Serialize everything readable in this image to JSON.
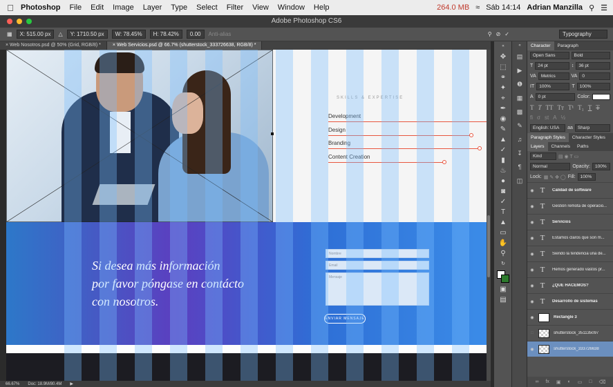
{
  "menubar": {
    "app": "Photoshop",
    "items": [
      "File",
      "Edit",
      "Image",
      "Layer",
      "Type",
      "Select",
      "Filter",
      "View",
      "Window",
      "Help"
    ],
    "memory": "264.0 MB",
    "clock": "Sáb 14:14",
    "user": "Adrian Manzilla"
  },
  "window": {
    "title": "Adobe Photoshop CS6"
  },
  "options": {
    "x": "X: 515.00 px",
    "y": "Y: 1710.50 px",
    "w": "W: 78.45%",
    "h": "H: 78.42%",
    "angle": "0.00",
    "antialias": "Anti-alias",
    "workspace": "Typography"
  },
  "tabs": [
    {
      "label": "Web Nosotros.psd @ 50% (Grid, RGB/8) *"
    },
    {
      "label": "Web Servicios.psd @ 66.7% (shutterstock_333726638, RGB/8) *"
    }
  ],
  "canvas": {
    "skills_title": "SKILLS & EXPERTISE",
    "skills": [
      {
        "label": "Development",
        "level": 1.0
      },
      {
        "label": "Design",
        "level": 0.9
      },
      {
        "label": "Branding",
        "level": 0.95
      },
      {
        "label": "Content Creation",
        "level": 0.73
      }
    ],
    "cta_line1": "Si desea más información",
    "cta_line2": "por favor póngase en contácto",
    "cta_line3": "con nosotros.",
    "form_name": "Nombre",
    "form_email": "Email",
    "form_message": "Mensaje",
    "send_button": "ENVIAR MENSAJE"
  },
  "status": {
    "zoom": "66.67%",
    "doc": "Doc: 18.9M/80.4M"
  },
  "character": {
    "tab1": "Character",
    "tab2": "Paragraph",
    "font": "Open Sans",
    "style": "Bold",
    "size": "24 pt",
    "leading": "36 pt",
    "kerning": "Metrics",
    "tracking": "0",
    "vscale": "100%",
    "hscale": "100%",
    "baseline": "0 pt",
    "color_label": "Color:",
    "language": "English: USA",
    "aa": "Sharp"
  },
  "styles": {
    "tab1": "Paragraph Styles",
    "tab2": "Character Styles"
  },
  "layers_panel": {
    "tab1": "Layers",
    "tab2": "Channels",
    "tab3": "Paths",
    "kind": "Kind",
    "blend": "Normal",
    "opacity_label": "Opacity:",
    "opacity": "100%",
    "lock_label": "Lock:",
    "fill_label": "Fill:",
    "fill": "100%",
    "layers": [
      {
        "name": "Calidad de software",
        "bold": true,
        "type": "text"
      },
      {
        "name": "Gestión remota de operacio...",
        "bold": false,
        "type": "text"
      },
      {
        "name": "Servicios",
        "bold": true,
        "type": "text"
      },
      {
        "name": "Estamos claros que son m...",
        "bold": false,
        "type": "text"
      },
      {
        "name": "Siendo la tendencia una de...",
        "bold": false,
        "type": "text"
      },
      {
        "name": "Hemos generado vastos pr...",
        "bold": false,
        "type": "text"
      },
      {
        "name": "¿QUÉ HACEMOS?",
        "bold": true,
        "type": "text"
      },
      {
        "name": "Desarrollo de sistemas",
        "bold": true,
        "type": "text"
      },
      {
        "name": "Rectangle 3",
        "bold": true,
        "type": "shape"
      },
      {
        "name": "shutterstock_351135097",
        "bold": false,
        "type": "smart"
      },
      {
        "name": "shutterstock_333726638",
        "bold": false,
        "type": "smart"
      }
    ]
  }
}
